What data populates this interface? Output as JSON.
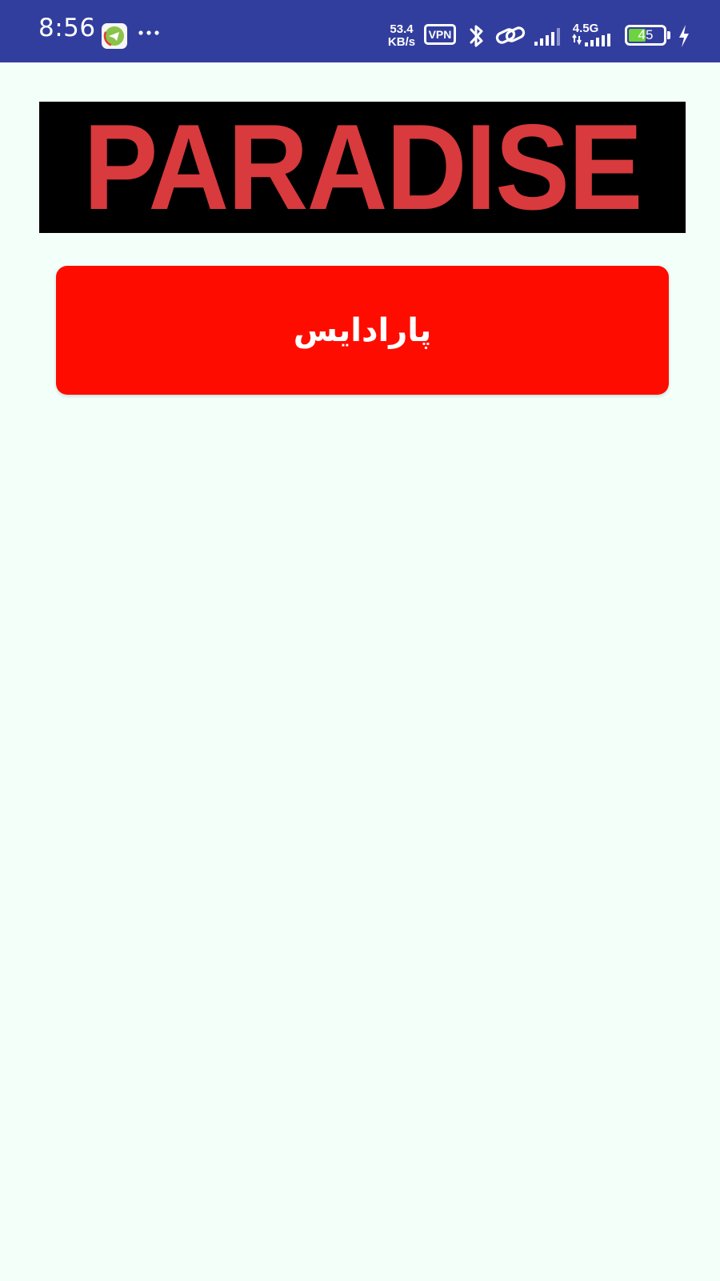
{
  "status_bar": {
    "time": "8:56",
    "net_speed_value": "53.4",
    "net_speed_unit": "KB/s",
    "vpn_label": "VPN",
    "network_type": "4.5G",
    "battery_level": "45",
    "battery_fraction": 0.45,
    "background_color": "#323e9e",
    "icons": [
      "telegram-app-icon",
      "more-dots-icon",
      "bluetooth-icon",
      "hotspot-link-icon",
      "signal-icon",
      "data-signal-icon",
      "battery-icon",
      "charging-icon"
    ]
  },
  "banner": {
    "text": "PARADISE",
    "text_color": "#d83a3d",
    "background_color": "#000000"
  },
  "main": {
    "primary_button_label": "پارادایس",
    "button_color": "#ff0c00",
    "background_color": "#f3fff9"
  }
}
